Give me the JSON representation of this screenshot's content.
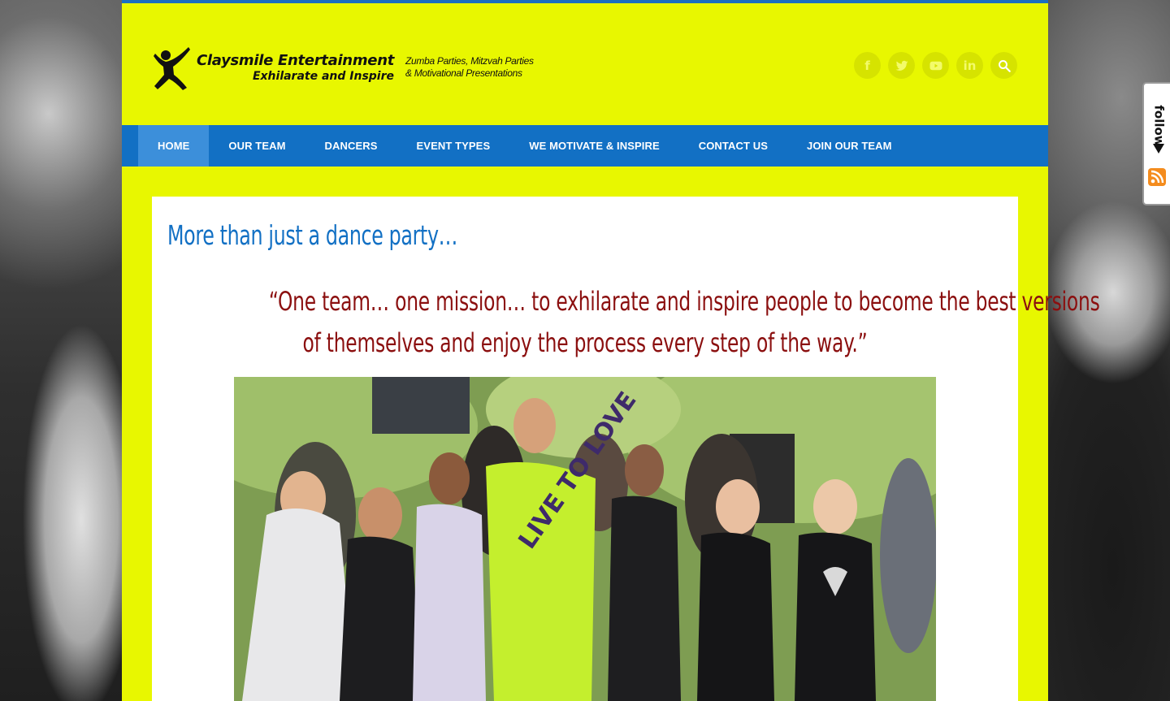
{
  "brand": {
    "name": "Claysmile Entertainment",
    "tagline": "Exhilarate and Inspire",
    "slogan_line1": "Zumba Parties, Mitzvah Parties",
    "slogan_line2": "& Motivational Presentations"
  },
  "social": {
    "items": [
      {
        "name": "facebook-icon",
        "glyph": "f"
      },
      {
        "name": "twitter-icon",
        "glyph": ""
      },
      {
        "name": "youtube-icon",
        "glyph": ""
      },
      {
        "name": "linkedin-icon",
        "glyph": "in"
      },
      {
        "name": "search-icon",
        "glyph": ""
      }
    ]
  },
  "nav": {
    "items": [
      {
        "label": "HOME",
        "active": true
      },
      {
        "label": "OUR TEAM"
      },
      {
        "label": "DANCERS"
      },
      {
        "label": "EVENT TYPES"
      },
      {
        "label": "WE MOTIVATE & INSPIRE"
      },
      {
        "label": "CONTACT US"
      },
      {
        "label": "JOIN OUR TEAM"
      }
    ]
  },
  "main": {
    "heading": "More than just a dance party…",
    "quote_line1": "“One team… one mission… to exhilarate and inspire people to become the best versions",
    "quote_line2": "of themselves and enjoy the process every step of the way.”",
    "photo_shirt_text": "LIVE TO LOVE"
  },
  "follow_widget": {
    "label": "follow"
  },
  "colors": {
    "page_bg": "#e8f700",
    "nav_bg": "#1270c4",
    "nav_active": "#3c8fda",
    "heading": "#1270c4",
    "quote": "#8b0f0f"
  }
}
